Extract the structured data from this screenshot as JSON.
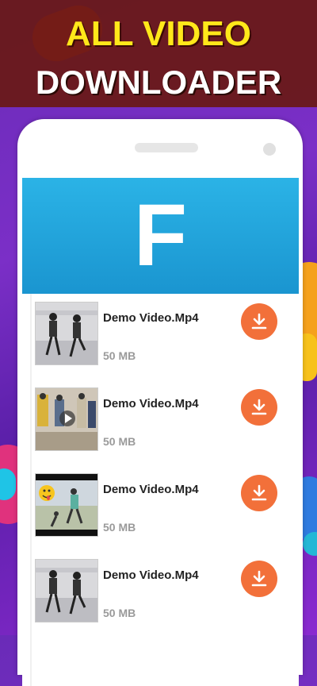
{
  "promo": {
    "title_line1": "ALL VIDEO",
    "title_line2": "DOWNLOADER"
  },
  "app": {
    "logo_letter": "F",
    "header_color": "#1a95d0",
    "accent_color": "#f2703a"
  },
  "videos": [
    {
      "title": "Demo Video.Mp4",
      "size": "50 MB",
      "thumb_icon": "dancers-thumbnail"
    },
    {
      "title": "Demo Video.Mp4",
      "size": "50 MB",
      "thumb_icon": "dance-group-thumbnail"
    },
    {
      "title": "Demo Video.Mp4",
      "size": "50 MB",
      "thumb_icon": "emoji-dance-thumbnail"
    },
    {
      "title": "Demo Video.Mp4",
      "size": "50 MB",
      "thumb_icon": "dancers-thumbnail"
    }
  ]
}
